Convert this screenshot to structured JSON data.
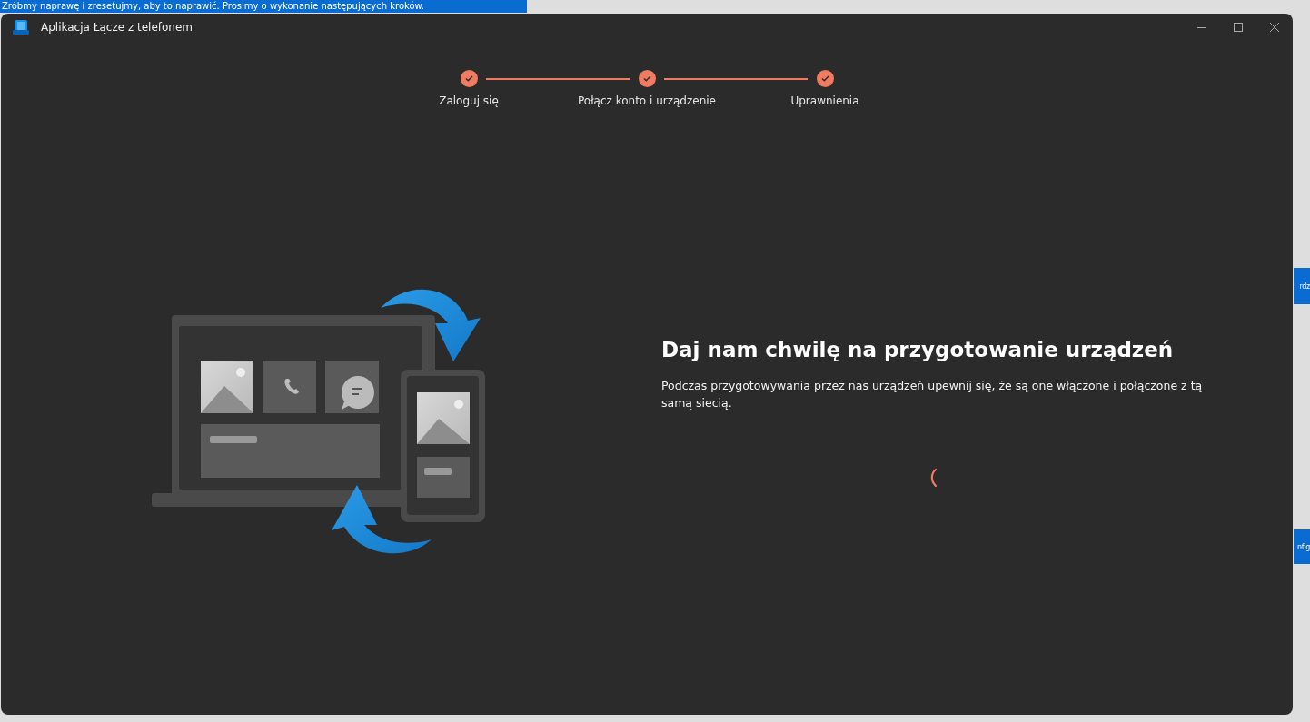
{
  "background": {
    "banner": "Zróbmy naprawę i zresetujmy, aby to naprawić. Prosimy o wykonanie następujących kroków.",
    "side_buttons": [
      "rdz",
      "nfig"
    ]
  },
  "window": {
    "title": "Aplikacja Łącze z telefonem"
  },
  "steps": [
    {
      "label": "Zaloguj się",
      "completed": true
    },
    {
      "label": "Połącz konto i urządzenie",
      "completed": true
    },
    {
      "label": "Uprawnienia",
      "completed": true
    }
  ],
  "content": {
    "heading": "Daj nam chwilę na przygotowanie urządzeń",
    "text": "Podczas przygotowywania przez nas urządzeń upewnij się, że są one włączone i połączone z tą samą siecią.",
    "loading": true
  }
}
